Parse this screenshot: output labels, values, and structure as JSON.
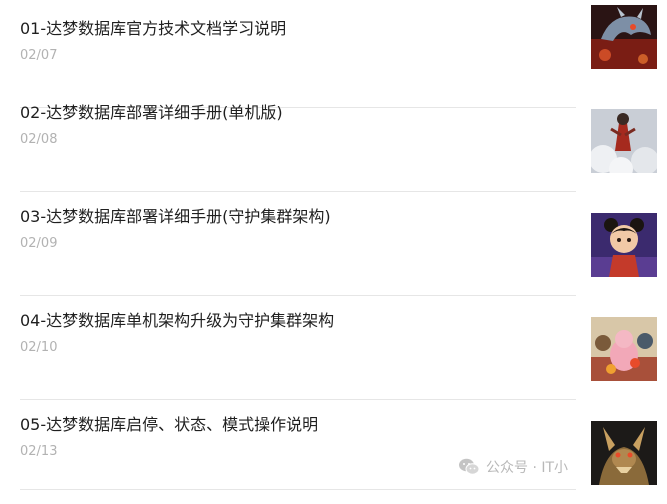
{
  "articles": [
    {
      "title": "01-达梦数据库官方技术文档学习说明",
      "date": "02/07",
      "thumbnail": "dragon-red-thumbnail"
    },
    {
      "title": "02-达梦数据库部署详细手册(单机版)",
      "date": "02/08",
      "thumbnail": "hero-clouds-thumbnail"
    },
    {
      "title": "03-达梦数据库部署详细手册(守护集群架构)",
      "date": "02/09",
      "thumbnail": "child-character-thumbnail"
    },
    {
      "title": "04-达梦数据库单机架构升级为守护集群架构",
      "date": "02/10",
      "thumbnail": "characters-group-thumbnail"
    },
    {
      "title": "05-达梦数据库启停、状态、模式操作说明",
      "date": "02/13",
      "thumbnail": "dragon-gold-thumbnail"
    }
  ],
  "watermark": {
    "text": "公众号 · IT小",
    "icon": "wechat-icon"
  }
}
